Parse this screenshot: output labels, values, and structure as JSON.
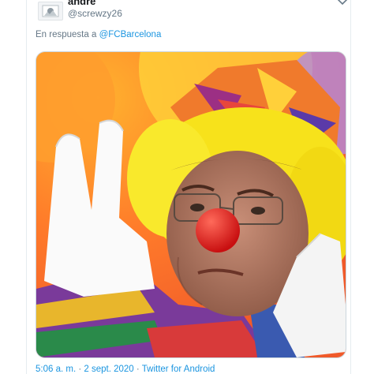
{
  "tweet": {
    "display_name": "andré",
    "handle": "@screwzy26",
    "reply_prefix": "En respuesta a",
    "reply_target": "@FCBarcelona",
    "time": "5:06 a. m.",
    "separator": "·",
    "date": "2 sept. 2020",
    "source": "Twitter for Android"
  },
  "icons": {
    "avatar": "avatar-icon",
    "more": "more-icon"
  },
  "colors": {
    "link": "#1b95e0",
    "muted": "#657786",
    "text": "#14171a"
  }
}
